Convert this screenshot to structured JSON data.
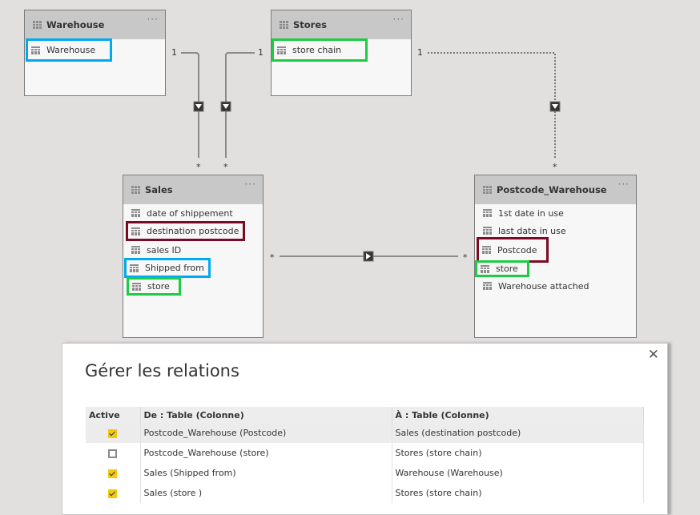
{
  "diagram": {
    "tables": [
      {
        "id": "warehouse",
        "title": "Warehouse",
        "fields": [
          {
            "label": "Warehouse",
            "highlight": "blue"
          }
        ]
      },
      {
        "id": "stores",
        "title": "Stores",
        "fields": [
          {
            "label": "store chain",
            "highlight": "green"
          }
        ]
      },
      {
        "id": "sales",
        "title": "Sales",
        "fields": [
          {
            "label": "date of shippement",
            "highlight": ""
          },
          {
            "label": "destination postcode",
            "highlight": "red"
          },
          {
            "label": "sales ID",
            "highlight": ""
          },
          {
            "label": "Shipped from",
            "highlight": "blue"
          },
          {
            "label": "store",
            "highlight": "green"
          }
        ]
      },
      {
        "id": "postcode_warehouse",
        "title": "Postcode_Warehouse",
        "fields": [
          {
            "label": "1st date in use",
            "highlight": ""
          },
          {
            "label": "last date in use",
            "highlight": ""
          },
          {
            "label": "Postcode",
            "highlight": "red"
          },
          {
            "label": "store",
            "highlight": "green"
          },
          {
            "label": "Warehouse attached",
            "highlight": ""
          }
        ]
      }
    ],
    "more_glyph": "···",
    "cardinality": {
      "one": "1",
      "many": "*"
    },
    "relationships": [
      {
        "from": "Sales",
        "to": "Warehouse",
        "active": true,
        "direction": "down"
      },
      {
        "from": "Sales",
        "to": "Stores",
        "active": true,
        "direction": "down"
      },
      {
        "from": "Postcode_Warehouse",
        "to": "Stores",
        "active": false,
        "direction": "down"
      },
      {
        "from": "Sales",
        "to": "Postcode_Warehouse",
        "active": true,
        "direction": "right"
      }
    ],
    "colors": {
      "blue": "#00aaee",
      "green": "#1ecb45",
      "red": "#7b0a22",
      "checkbox": "#f2c811"
    }
  },
  "dialog": {
    "title": "Gérer les relations",
    "close_icon": "✕",
    "columns": [
      "Active",
      "De : Table (Colonne)",
      "À : Table (Colonne)"
    ],
    "rows": [
      {
        "active": true,
        "from": "Postcode_Warehouse (Postcode)",
        "to": "Sales (destination postcode)",
        "selected": true
      },
      {
        "active": false,
        "from": "Postcode_Warehouse (store)",
        "to": "Stores (store chain)",
        "selected": false
      },
      {
        "active": true,
        "from": "Sales (Shipped from)",
        "to": "Warehouse (Warehouse)",
        "selected": false
      },
      {
        "active": true,
        "from": "Sales (store )",
        "to": "Stores (store chain)",
        "selected": false
      }
    ]
  }
}
